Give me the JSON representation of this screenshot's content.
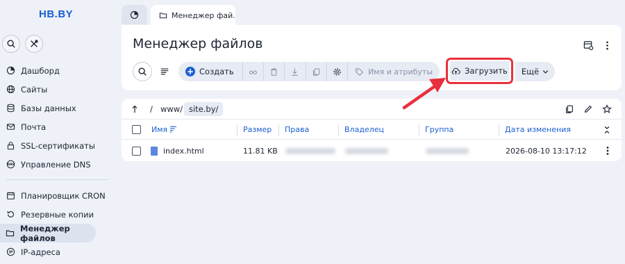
{
  "app": {
    "logo": "HB.BY"
  },
  "sidebar": {
    "items": [
      {
        "label": "Дашборд",
        "icon": "dashboard-icon"
      },
      {
        "label": "Сайты",
        "icon": "globe-icon"
      },
      {
        "label": "Базы данных",
        "icon": "database-icon"
      },
      {
        "label": "Почта",
        "icon": "mail-icon"
      },
      {
        "label": "SSL-сертификаты",
        "icon": "lock-icon"
      },
      {
        "label": "Управление DNS",
        "icon": "dns-icon"
      },
      {
        "label": "Планировщик CRON",
        "icon": "calendar-icon"
      },
      {
        "label": "Резервные копии",
        "icon": "backup-icon"
      },
      {
        "label": "Менеджер файлов",
        "icon": "folder-icon",
        "active": true
      },
      {
        "label": "IP-адреса",
        "icon": "ip-icon"
      }
    ]
  },
  "tabs": {
    "active": "Менеджер фай..."
  },
  "header": {
    "title": "Менеджер файлов"
  },
  "toolbar": {
    "create": "Создать",
    "attributes": "Имя и атрибуты",
    "upload": "Загрузить",
    "more": "Ещё"
  },
  "path": {
    "separator": "/",
    "www": "www/",
    "site": "site.by/"
  },
  "table": {
    "columns": {
      "name": "Имя",
      "size": "Размер",
      "rights": "Права",
      "owner": "Владелец",
      "group": "Группа",
      "modified": "Дата изменения"
    },
    "rows": [
      {
        "name": "index.html",
        "size": "11.81 KB",
        "modified": "2026-08-10 13:17:12"
      }
    ]
  },
  "colors": {
    "accent": "#1b5fd2",
    "highlight": "#e8303d",
    "background": "#eef1f7"
  }
}
